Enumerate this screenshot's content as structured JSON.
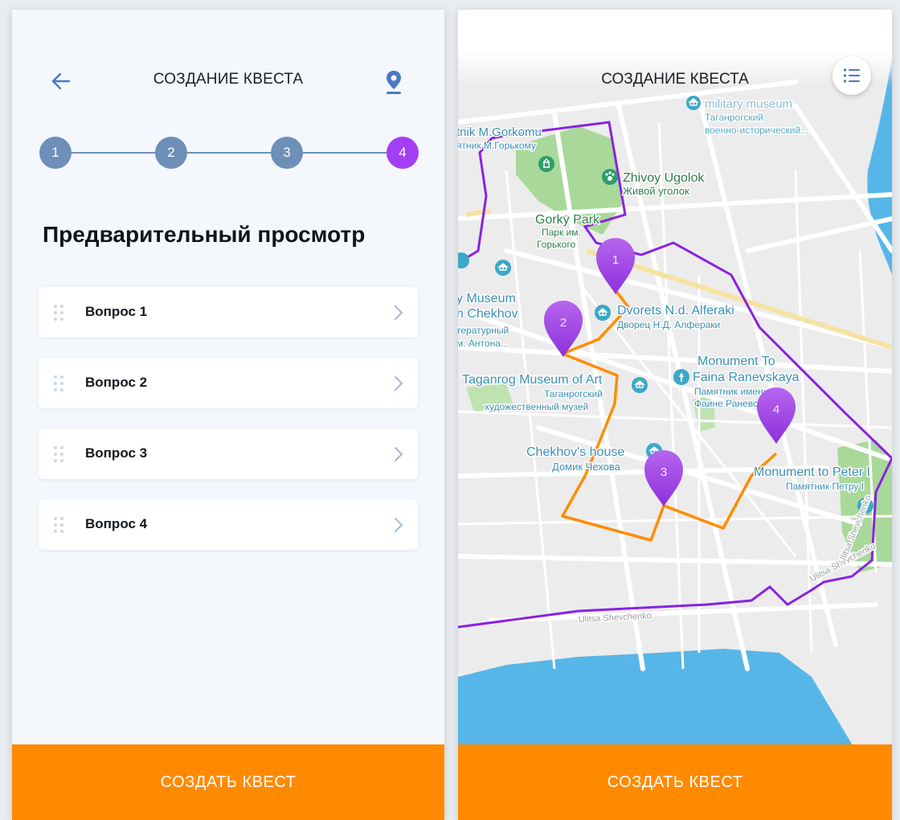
{
  "left": {
    "title": "СОЗДАНИЕ КВЕСТА",
    "steps": [
      "1",
      "2",
      "3",
      "4"
    ],
    "active_step": "4",
    "section_title": "Предварительный просмотр",
    "questions": [
      {
        "label": "Вопрос 1"
      },
      {
        "label": "Вопрос 2"
      },
      {
        "label": "Вопрос 3"
      },
      {
        "label": "Вопрос 4"
      }
    ],
    "cta": "СОЗДАТЬ КВЕСТ"
  },
  "right": {
    "title": "СОЗДАНИЕ КВЕСТА",
    "cta": "СОЗДАТЬ КВЕСТ",
    "map": {
      "markers": [
        "1",
        "2",
        "3",
        "4"
      ],
      "labels": {
        "military_1": "military museum",
        "military_2": "Таганрогский",
        "military_3": "военно-исторический...",
        "gorkomu_1": "tnik M.Gorkomu",
        "gorkomu_2": "ятник М.Горькому",
        "zhivoy_1": "Zhivoy Ugolok",
        "zhivoy_2": "Живой уголок",
        "gorky_1": "Gorky Park",
        "gorky_2": "Парк им.",
        "gorky_3": "Горького",
        "chekhov_lit_1": "y Museum",
        "chekhov_lit_2": "n Chekhov",
        "chekhov_lit_3": "тературный",
        "chekhov_lit_4": "м. Антона...",
        "dvorets_1": "Dvorets N.d. Alferaki",
        "dvorets_2": "Дворец Н.Д. Алфераки",
        "ranev_1": "Monument To",
        "ranev_2": "Faina Ranevskaya",
        "ranev_3": "Памятник имени",
        "ranev_4": "Фаине Раневской",
        "art_1": "Taganrog Museum of Art",
        "art_2": "Таганрогский",
        "art_3": "художественный музей",
        "house_1": "Chekhov's house",
        "house_2": "Домик Чехова",
        "peter_1": "Monument to Peter I",
        "peter_2": "Памятник Петру I",
        "street_1": "Ulitsa Shevchenko",
        "street_2": "Ulitsa Shevchenko",
        "street_3": "Ulitsa Shevchenko"
      }
    }
  },
  "colors": {
    "step_done": "#6d8fb8",
    "step_active": "#a43ef4",
    "accent_orange": "#ff8a00",
    "route_orange": "#ff8c00",
    "boundary_purple": "#8a22e0",
    "marker_purple": "#a44be8",
    "sea_blue": "#57b6e8",
    "park_green": "#a9d99a"
  },
  "icons": {
    "back": "arrow-left-icon",
    "location": "location-pin-icon",
    "drag": "drag-handle-icon",
    "chevron": "chevron-right-icon",
    "list": "numbered-list-icon",
    "poi": "museum-icon"
  }
}
